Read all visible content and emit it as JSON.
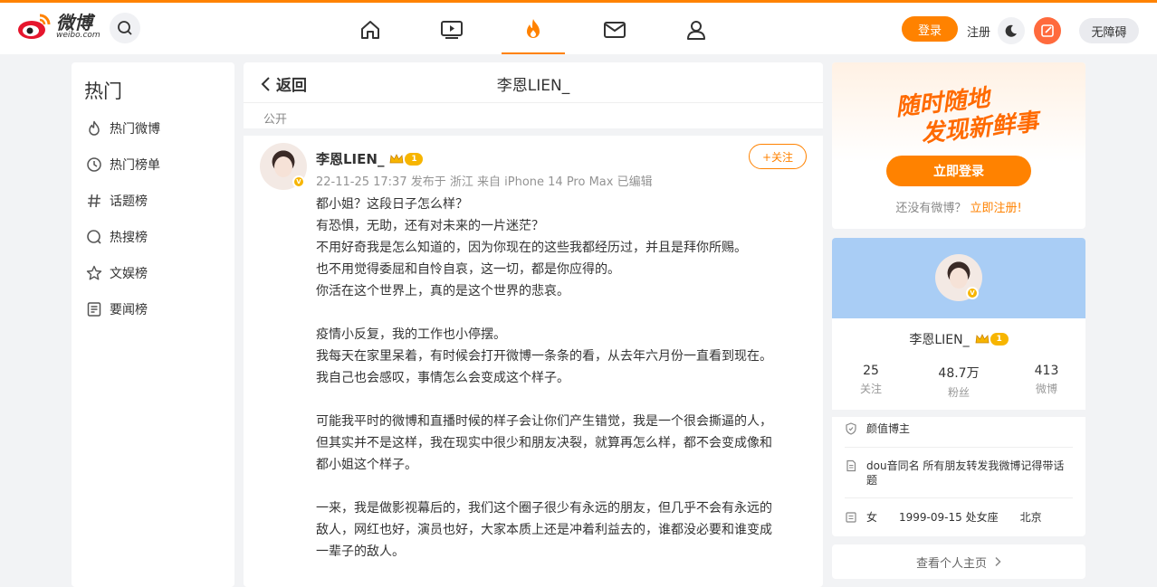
{
  "logo": {
    "cn": "微博",
    "en": "weibo.com"
  },
  "header": {
    "login": "登录",
    "register": "注册",
    "accessibility": "无障碍",
    "nav": [
      "home-icon",
      "video-icon",
      "hot-icon",
      "mail-icon",
      "profile-icon"
    ],
    "accent": "#ff8200"
  },
  "sidebar": {
    "heading": "热门",
    "items": [
      {
        "label": "热门微博",
        "icon": "flame-icon"
      },
      {
        "label": "热门榜单",
        "icon": "clock-icon"
      },
      {
        "label": "话题榜",
        "icon": "hash-icon"
      },
      {
        "label": "热搜榜",
        "icon": "search-ring-icon"
      },
      {
        "label": "文娱榜",
        "icon": "star-icon"
      },
      {
        "label": "要闻榜",
        "icon": "news-icon"
      }
    ]
  },
  "main": {
    "back": "返回",
    "title": "李恩LIEN_",
    "visibility": "公开",
    "post": {
      "author": "李恩LIEN_",
      "level": "1",
      "meta": "22-11-25 17:37 发布于 浙江 来自 iPhone 14 Pro Max 已编辑",
      "follow": "+关注",
      "lines": [
        "都小姐？这段日子怎么样？",
        "有恐惧，无助，还有对未来的一片迷茫？",
        "不用好奇我是怎么知道的，因为你现在的这些我都经历过，并且是拜你所赐。",
        "也不用觉得委屈和自怜自哀，这一切，都是你应得的。",
        "你活在这个世界上，真的是这个世界的悲哀。",
        "",
        "疫情小反复，我的工作也小停摆。",
        "我每天在家里呆着，有时候会打开微博一条条的看，从去年六月份一直看到现在。",
        "我自己也会感叹，事情怎么会变成这个样子。",
        "",
        "可能我平时的微博和直播时候的样子会让你们产生错觉，我是一个很会撕逼的人，",
        "但其实并不是这样，我在现实中很少和朋友决裂，就算再怎么样，都不会变成像和",
        "都小姐这个样子。",
        "",
        "一来，我是做影视幕后的，我们这个圈子很少有永远的朋友，但几乎不会有永远的",
        "敌人，网红也好，演员也好，大家本质上还是冲着利益去的，谁都没必要和谁变成",
        "一辈子的敌人。"
      ]
    }
  },
  "promo": {
    "slogan_line1": "随时随地",
    "slogan_line2": "发现新鲜事",
    "login_button": "立即登录",
    "hint": "还没有微博？",
    "register_link": "立即注册!"
  },
  "profile": {
    "name": "李恩LIEN_",
    "level": "1",
    "stats": [
      {
        "num": "25",
        "label": "关注"
      },
      {
        "num": "48.7万",
        "label": "粉丝"
      },
      {
        "num": "413",
        "label": "微博"
      }
    ],
    "tag": "颜值博主",
    "bio": "dou音同名 所有朋友转发我微博记得带话题",
    "gender": "女",
    "birthday": "1999-09-15 处女座",
    "location": "北京",
    "homepage": "查看个人主页"
  }
}
